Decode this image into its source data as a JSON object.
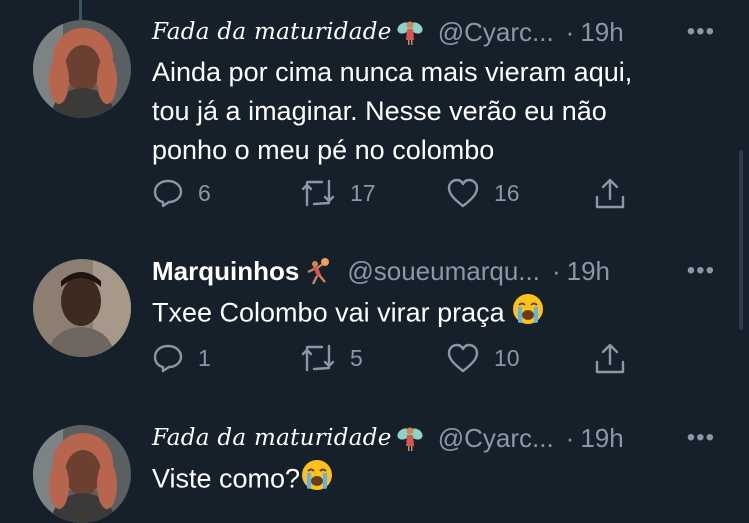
{
  "tweets": [
    {
      "name": "Fada da maturidade",
      "name_style": "italic",
      "badge_icon": "fairy-emoji",
      "handle": "@Cyarc...",
      "dot": "·",
      "time": "19h",
      "text_lines": [
        "Ainda por cima nunca mais vieram aqui,",
        "tou já a imaginar. Nesse verão eu não",
        "ponho o meu pé no colombo"
      ],
      "replies": "6",
      "retweets": "17",
      "likes": "16"
    },
    {
      "name": "Marquinhos",
      "name_style": "bold",
      "badge_icon": "handball-emoji",
      "handle": "@soueumarqu...",
      "dot": "·",
      "time": "19h",
      "text": "Txee Colombo vai virar praça",
      "text_emoji": "loudly-crying-face-emoji",
      "replies": "1",
      "retweets": "5",
      "likes": "10"
    },
    {
      "name": "Fada da maturidade",
      "name_style": "italic",
      "badge_icon": "fairy-emoji",
      "handle": "@Cyarc...",
      "dot": "·",
      "time": "19h",
      "text": "Viste como?",
      "text_emoji": "loudly-crying-face-emoji"
    }
  ],
  "more_label": "•••",
  "colors": {
    "background": "#15202b",
    "secondary_text": "#8899a6",
    "primary_text": "#ffffff"
  }
}
